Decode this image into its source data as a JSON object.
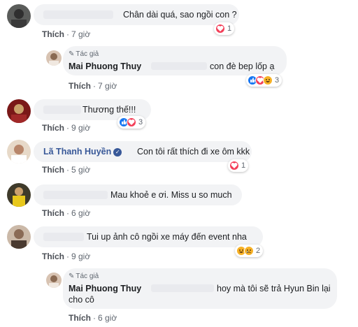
{
  "colors": {
    "link": "#385898",
    "bubble": "#f2f3f5",
    "like": "#1877f2",
    "love": "#f33e58",
    "haha": "#f7b125"
  },
  "comments": [
    {
      "text": "Chân dài quá, sao ngồi con ?",
      "like_label": "Thích",
      "time": "7 giờ",
      "reactions": [
        "love"
      ],
      "count": "1"
    },
    {
      "author_tag": "Tác giả",
      "name": "Mai Phuong Thuy",
      "text": "con đè bep lốp ạ",
      "like_label": "Thích",
      "time": "7 giờ",
      "reactions": [
        "like",
        "love",
        "haha"
      ],
      "count": "3"
    },
    {
      "text": "Thương thế!!!",
      "like_label": "Thích",
      "time": "9 giờ",
      "reactions": [
        "like",
        "love"
      ],
      "count": "3"
    },
    {
      "name": "Lã Thanh Huyền",
      "text": "Con tôi rất thích đi xe ôm kkk",
      "like_label": "Thích",
      "time": "5 giờ",
      "reactions": [
        "love"
      ],
      "count": "1"
    },
    {
      "text": "Mau khoẻ e ơi. Miss u so much",
      "like_label": "Thích",
      "time": "6 giờ"
    },
    {
      "text": "Tui up ảnh cô ngồi xe máy đến event nha",
      "like_label": "Thích",
      "time": "9 giờ",
      "reactions": [
        "haha",
        "sad"
      ],
      "count": "2"
    },
    {
      "author_tag": "Tác giả",
      "name": "Mai Phuong Thuy",
      "text": "hoy mà tôi sẽ trả Hyun Bin lại",
      "text2": "cho cô",
      "like_label": "Thích",
      "time": "6 giờ"
    }
  ],
  "separator": "·"
}
